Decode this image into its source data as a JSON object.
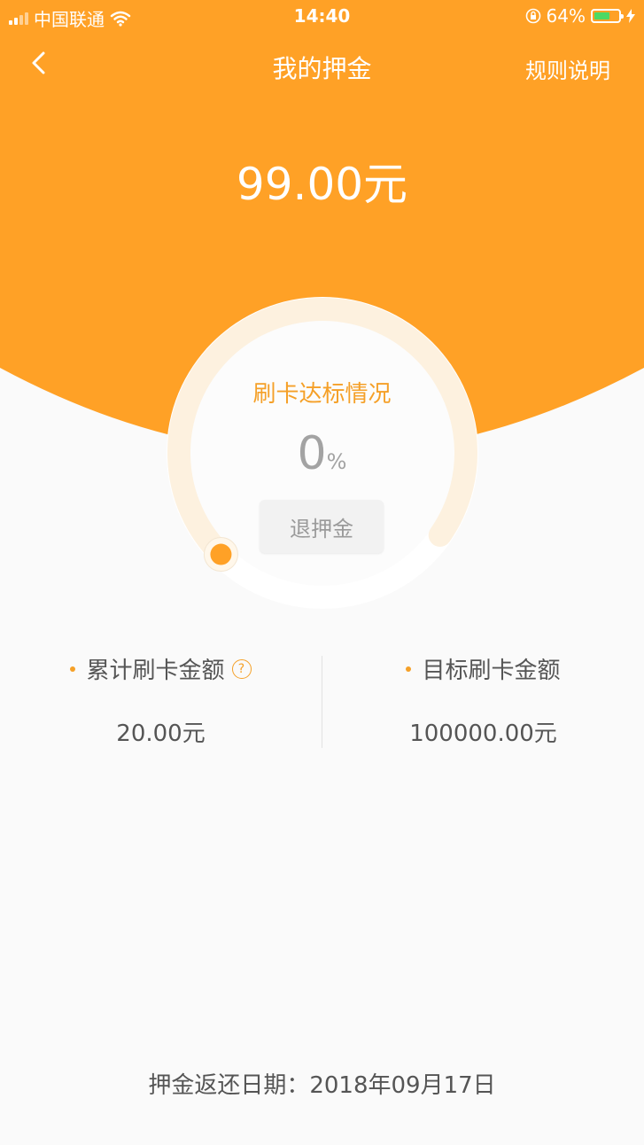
{
  "status_bar": {
    "carrier": "中国联通",
    "time": "14:40",
    "battery": "64%",
    "battery_level": 0.64
  },
  "nav": {
    "title": "我的押金",
    "rules_label": "规则说明"
  },
  "deposit": {
    "amount": "99.00元"
  },
  "progress": {
    "label": "刷卡达标情况",
    "percent": "0",
    "percent_unit": "%",
    "value": 0
  },
  "refund_button": {
    "label": "退押金"
  },
  "stats": {
    "accumulated": {
      "label": "累计刷卡金额",
      "value": "20.00元"
    },
    "target": {
      "label": "目标刷卡金额",
      "value": "100000.00元"
    }
  },
  "footer": {
    "return_date": "押金返还日期：2018年09月17日"
  },
  "colors": {
    "accent": "#ffa126",
    "orange_text": "#f5a028",
    "track": "#fdf1df",
    "battery_fill": "#4cd964"
  },
  "icons": {
    "back": "chevron-left-icon",
    "help": "question-circle-icon",
    "wifi": "wifi-icon",
    "lock": "rotation-lock-icon",
    "charging": "bolt-icon"
  }
}
